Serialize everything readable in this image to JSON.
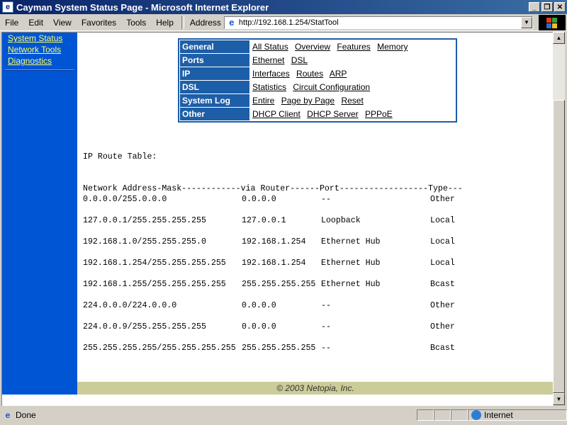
{
  "window": {
    "title": "Cayman System Status Page - Microsoft Internet Explorer"
  },
  "menu": [
    "File",
    "Edit",
    "View",
    "Favorites",
    "Tools",
    "Help"
  ],
  "address": {
    "label": "Address",
    "url": "http://192.168.1.254/StatTool"
  },
  "leftnav": {
    "items": [
      "System Status",
      "Network Tools",
      "Diagnostics"
    ]
  },
  "status_menu": [
    {
      "category": "General",
      "links": [
        "All Status",
        "Overview",
        "Features",
        "Memory"
      ]
    },
    {
      "category": "Ports",
      "links": [
        "Ethernet",
        "DSL"
      ]
    },
    {
      "category": "IP",
      "links": [
        "Interfaces",
        "Routes",
        "ARP"
      ]
    },
    {
      "category": "DSL",
      "links": [
        "Statistics",
        "Circuit Configuration"
      ]
    },
    {
      "category": "System Log",
      "links": [
        "Entire",
        "Page by Page",
        "Reset"
      ]
    },
    {
      "category": "Other",
      "links": [
        "DHCP Client",
        "DHCP Server",
        "PPPoE"
      ]
    }
  ],
  "route_table": {
    "title": "IP Route Table:",
    "header": "Network Address-Mask------------via Router------Port------------------Type---",
    "rows": [
      [
        "0.0.0.0/255.0.0.0",
        "0.0.0.0",
        "--",
        "Other"
      ],
      [
        "127.0.0.1/255.255.255.255",
        "127.0.0.1",
        "Loopback",
        "Local"
      ],
      [
        "192.168.1.0/255.255.255.0",
        "192.168.1.254",
        "Ethernet Hub",
        "Local"
      ],
      [
        "192.168.1.254/255.255.255.255",
        "192.168.1.254",
        "Ethernet Hub",
        "Local"
      ],
      [
        "192.168.1.255/255.255.255.255",
        "255.255.255.255",
        "Ethernet Hub",
        "Bcast"
      ],
      [
        "224.0.0.0/224.0.0.0",
        "0.0.0.0",
        "--",
        "Other"
      ],
      [
        "224.0.0.9/255.255.255.255",
        "0.0.0.0",
        "--",
        "Other"
      ],
      [
        "255.255.255.255/255.255.255.255",
        "255.255.255.255",
        "--",
        "Bcast"
      ]
    ]
  },
  "footer": {
    "text": "© 2003 Netopia, Inc."
  },
  "statusbar": {
    "status": "Done",
    "zone": "Internet"
  },
  "colors": {
    "titlebar": "#0a246a",
    "nav": "#0055d4",
    "nav_link": "#ffff66",
    "table_header": "#1d5ea8",
    "footer": "#cccc99"
  }
}
